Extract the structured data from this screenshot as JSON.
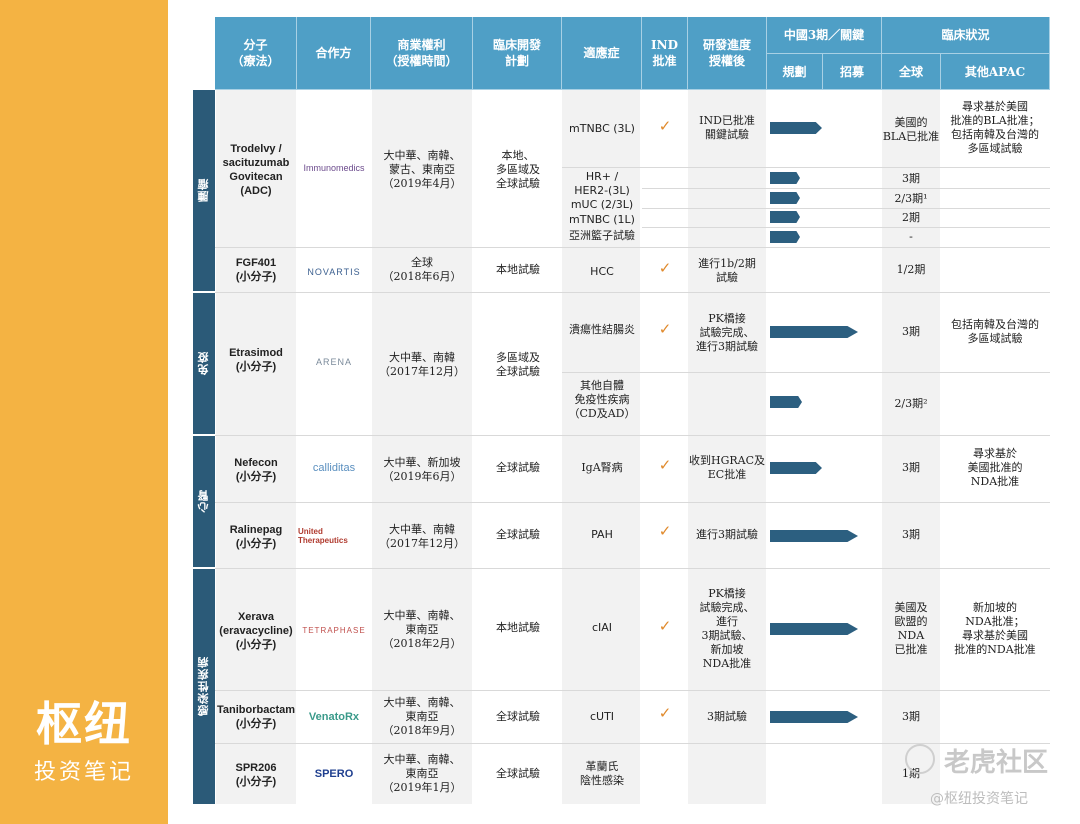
{
  "brand": {
    "title": "枢纽",
    "subtitle": "投资笔记"
  },
  "headers": {
    "molecule": "分子\n（療法）",
    "partner": "合作方",
    "rights": "商業權利\n（授權時間）",
    "plan": "臨床開發\n計劃",
    "indication": "適應症",
    "ind": "IND\n批准",
    "progress": "研發進度\n授權後",
    "china3": "中國3期／關鍵",
    "planning": "規劃",
    "recruit": "招募",
    "clinical": "臨床狀況",
    "global": "全球",
    "apac": "其他APAC"
  },
  "categories": {
    "oncology": "腫瘤",
    "immunology": "免疫",
    "cardio": "心腎",
    "infectious": "感染性疾病"
  },
  "rows": {
    "trodelvy": {
      "name": "Trodelvy /\nsacituzumab\nGovitecan\n(ADC)",
      "partner": "Immunomedics",
      "rights": "大中華、南韓、\n蒙古、東南亞\n（2019年4月）",
      "plan": "本地、\n多區域及\n全球試驗",
      "ind1": "mTNBC (3L)",
      "check": "✓",
      "progress": "IND已批准\n關鍵試驗",
      "global1": "美國的\nBLA已批准",
      "apac1": "尋求基於美國\n批准的BLA批准；\n包括南韓及台灣的\n多區域試驗",
      "ind2": "HR+ /\nHER2-(3L)",
      "global2": "3期",
      "ind3": "mUC (2/3L)",
      "global3": "2/3期¹",
      "ind4": "mTNBC (1L)",
      "global4": "2期",
      "ind5": "亞洲籃子試驗",
      "global5": "-"
    },
    "fgf401": {
      "name": "FGF401\n(小分子)",
      "partner": "NOVARTIS",
      "rights": "全球\n（2018年6月）",
      "plan": "本地試驗",
      "ind": "HCC",
      "check": "✓",
      "progress": "進行1b/2期\n試驗",
      "global": "1/2期"
    },
    "etrasimod": {
      "name": "Etrasimod\n(小分子)",
      "partner": "ARENA",
      "rights": "大中華、南韓\n（2017年12月）",
      "plan": "多區域及\n全球試驗",
      "ind1": "潰瘍性結腸炎",
      "check": "✓",
      "progress": "PK橋接\n試驗完成、\n進行3期試驗",
      "global1": "3期",
      "apac1": "包括南韓及台灣的\n多區域試驗",
      "ind2": "其他自體\n免疫性疾病\n（CD及AD）",
      "global2": "2/3期²"
    },
    "nefecon": {
      "name": "Nefecon\n(小分子)",
      "partner": "calliditas",
      "rights": "大中華、新加坡\n（2019年6月）",
      "plan": "全球試驗",
      "ind": "IgA腎病",
      "check": "✓",
      "progress": "收到HGRAC及\nEC批准",
      "global": "3期",
      "apac": "尋求基於\n美國批准的\nNDA批准"
    },
    "ralinepag": {
      "name": "Ralinepag\n(小分子)",
      "partner": "United Therapeutics",
      "rights": "大中華、南韓\n（2017年12月）",
      "plan": "全球試驗",
      "ind": "PAH",
      "check": "✓",
      "progress": "進行3期試驗",
      "global": "3期"
    },
    "xerava": {
      "name": "Xerava\n(eravacycline)\n(小分子)",
      "partner": "TETRAPHASE",
      "rights": "大中華、南韓、\n東南亞\n（2018年2月）",
      "plan": "本地試驗",
      "ind": "cIAI",
      "check": "✓",
      "progress": "PK橋接\n試驗完成、\n進行\n3期試驗、\n新加坡\nNDA批准",
      "global": "美國及\n歐盟的\nNDA\n已批准",
      "apac": "新加坡的\nNDA批准；\n尋求基於美國\n批准的NDA批准"
    },
    "taniborbactam": {
      "name": "Taniborbactam\n(小分子)",
      "partner": "VenatoRx",
      "rights": "大中華、南韓、\n東南亞\n（2018年9月）",
      "plan": "全球試驗",
      "ind": "cUTI",
      "check": "✓",
      "progress": "3期試驗",
      "global": "3期"
    },
    "spr206": {
      "name": "SPR206\n(小分子)",
      "partner": "SPERO",
      "rights": "大中華、南韓、\n東南亞\n（2019年1月）",
      "plan": "全球試驗",
      "ind": "革蘭氏\n陰性感染",
      "global": "1期"
    }
  },
  "watermark": {
    "main": "老虎社区",
    "sub": "@枢纽投资笔记"
  }
}
